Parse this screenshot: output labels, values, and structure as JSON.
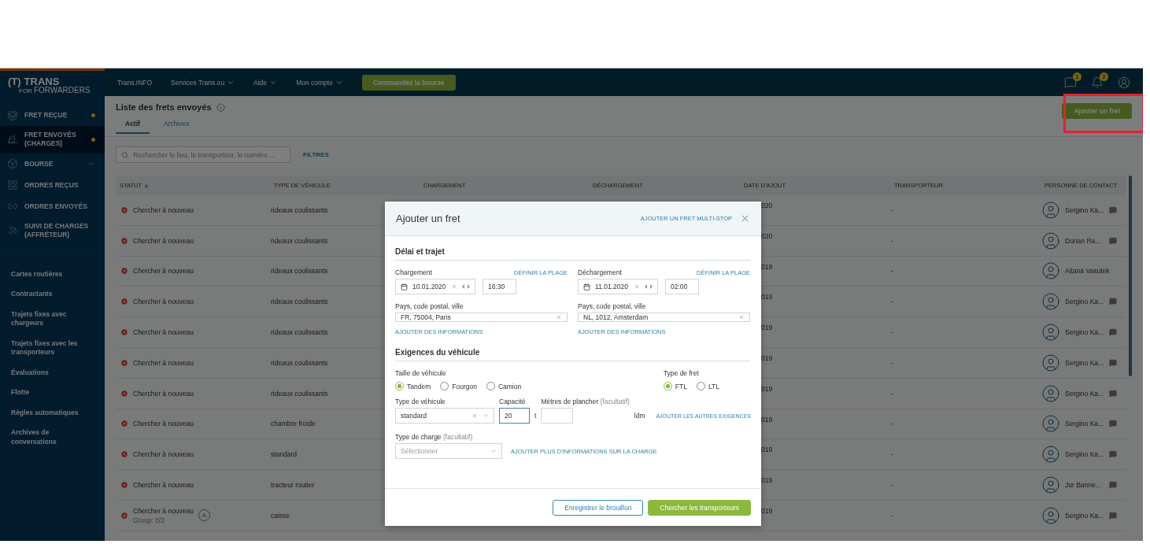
{
  "topbar": {
    "logo": {
      "mark": "(T)",
      "name": "TRANS",
      "prefix": "FOR",
      "suffix": "FORWARDERS"
    },
    "menu": [
      {
        "label": "Trans.INFO",
        "dropdown": false
      },
      {
        "label": "Services Trans.eu",
        "dropdown": true
      },
      {
        "label": "Aide",
        "dropdown": true
      },
      {
        "label": "Mon compte",
        "dropdown": true
      }
    ],
    "cta": "Commandez la bourse",
    "icons": [
      {
        "kind": "chat",
        "badge": "1"
      },
      {
        "kind": "bell",
        "badge": "2"
      },
      {
        "kind": "account"
      }
    ]
  },
  "sidebar": {
    "items": [
      {
        "label": "FRET REÇUE",
        "dot": true,
        "selected": false,
        "expandable": false
      },
      {
        "label": "FRET ENVOYÉS (CHARGES)",
        "dot": true,
        "selected": true,
        "expandable": false
      },
      {
        "label": "BOURSE",
        "dot": false,
        "selected": false,
        "expandable": true
      },
      {
        "label": "ORDRES REÇUS",
        "dot": false,
        "selected": false,
        "expandable": false
      },
      {
        "label": "ORDRES ENVOYÉS",
        "dot": false,
        "selected": false,
        "expandable": false
      },
      {
        "label": "SUIVI DE CHARGES (AFFRÉTEUR)",
        "dot": false,
        "selected": false,
        "expandable": false
      }
    ],
    "links": [
      "Cartes routières",
      "Contractants",
      "Trajets fixes avec chargeurs",
      "Trajets fixes avec les transporteurs",
      "Évaluations",
      "Flotte",
      "Règles automatiques",
      "Archives de conversations"
    ]
  },
  "page": {
    "title": "Liste des frets envoyés",
    "tabs": [
      {
        "label": "Actif",
        "selected": true
      },
      {
        "label": "Archives",
        "selected": false
      }
    ],
    "add_button": "Ajouter un fret",
    "search": {
      "placeholder": "Rechercher le lieu, le transporteur, le numéro ..."
    },
    "filters": "FILTRES"
  },
  "table": {
    "columns": [
      "STATUT",
      "TYPE DE VÉHICULE",
      "CHARGEMENT",
      "DÉCHARGEMENT",
      "DATE D'AJOUT",
      "TRANSPORTEUR",
      "PERSONNE DE CONTACT"
    ],
    "rows": [
      {
        "status": "Chercher à nouveau",
        "vehicle": "rideaux coulissants",
        "date": "020",
        "carrier": "-",
        "contact": "Sergino Ka...",
        "message": true
      },
      {
        "status": "Chercher à nouveau",
        "vehicle": "rideaux coulissants",
        "date": "020",
        "carrier": "-",
        "contact": "Dorian Ra...",
        "message": true
      },
      {
        "status": "Chercher à nouveau",
        "vehicle": "rideaux coulissants",
        "date": "019",
        "carrier": "-",
        "contact": "Aitana Vasutek",
        "message": false
      },
      {
        "status": "Chercher à nouveau",
        "vehicle": "rideaux coulissants",
        "date": "019",
        "carrier": "-",
        "contact": "Sergino Ka...",
        "message": true
      },
      {
        "status": "Chercher à nouveau",
        "vehicle": "rideaux coulissants",
        "date": "019",
        "carrier": "-",
        "contact": "Sergino Ka...",
        "message": true
      },
      {
        "status": "Chercher à nouveau",
        "vehicle": "rideaux coulissants",
        "date": "019",
        "carrier": "-",
        "contact": "Sergino Ka...",
        "message": true
      },
      {
        "status": "Chercher à nouveau",
        "vehicle": "rideaux coulissants",
        "date": "019",
        "carrier": "-",
        "contact": "Sergino Ka...",
        "message": true
      },
      {
        "status": "Chercher à nouveau",
        "vehicle": "chambre froide",
        "date": "019",
        "carrier": "-",
        "contact": "Sergino Ka...",
        "message": true
      },
      {
        "status": "Chercher à nouveau",
        "vehicle": "standard",
        "date": "019",
        "carrier": "-",
        "contact": "Sergino Ka...",
        "message": true
      },
      {
        "status": "Chercher à nouveau",
        "vehicle": "tracteur routier",
        "date": "019",
        "carrier": "-",
        "contact": "Jur Banne...",
        "message": true
      },
      {
        "status": "Chercher à nouveau",
        "group": "Group: 0/2",
        "badge": "A",
        "vehicle": "caisse",
        "date": "019",
        "carrier": "-",
        "contact": "Sergino Ka...",
        "message": true
      }
    ]
  },
  "modal": {
    "title": "Ajouter un fret",
    "multi_stop": "AJOUTER UN FRET MULTI-STOP",
    "section_route": "Délai et trajet",
    "stops": [
      {
        "label": "Chargement",
        "range": "DÉFINIR LA PLAGE",
        "date": "10.01.2020",
        "time": "16:30",
        "place_label": "Pays, code postal, ville",
        "place": "FR, 75004, Paris",
        "more": "AJOUTER DES INFORMATIONS"
      },
      {
        "label": "Déchargement",
        "range": "DÉFINIR LA PLAGE",
        "date": "11.01.2020",
        "time": "02:00",
        "place_label": "Pays, code postal, ville",
        "place": "NL, 1012, Amsterdam",
        "more": "AJOUTER DES INFORMATIONS"
      }
    ],
    "section_vehicle": "Exigences du véhicule",
    "size": {
      "label": "Taille de véhicule",
      "options": [
        {
          "label": "Tandem",
          "selected": true
        },
        {
          "label": "Fourgon",
          "selected": false
        },
        {
          "label": "Camion",
          "selected": false
        }
      ]
    },
    "freight": {
      "label": "Type de fret",
      "options": [
        {
          "label": "FTL",
          "selected": true
        },
        {
          "label": "LTL",
          "selected": false
        }
      ]
    },
    "vehicle_type": {
      "label": "Type de véhicule",
      "value": "standard"
    },
    "capacity": {
      "label": "Capacité",
      "value": "20",
      "unit": "t",
      "focused": true
    },
    "floor": {
      "label": "Mètres de plancher",
      "hint": "(facultatif)",
      "unit": "ldm"
    },
    "other_link": "AJOUTER LES AUTRES EXIGENCES",
    "load_type": {
      "label": "Type de charge",
      "hint": "(facultatif)",
      "placeholder": "Sélectionner"
    },
    "load_link": "AJOUTER PLUS D'INFORMATIONS SUR LA CHARGE",
    "buttons": [
      {
        "label": "Enregistrer le brouillon",
        "kind": "outline"
      },
      {
        "label": "Chercher les transporteurs",
        "kind": "primary"
      }
    ]
  }
}
